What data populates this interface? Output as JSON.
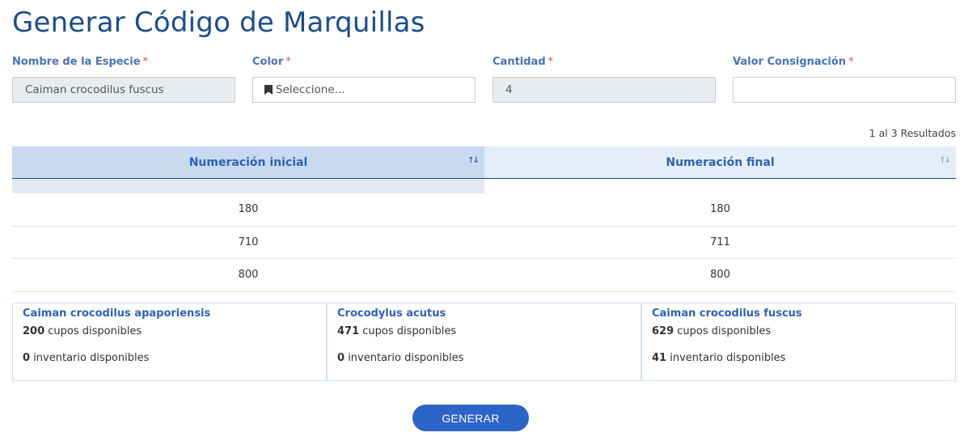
{
  "page": {
    "title": "Generar Código de Marquillas"
  },
  "form": {
    "species": {
      "label": "Nombre de la Especie",
      "required_mark": "*",
      "value": "Caiman crocodilus fuscus"
    },
    "color": {
      "label": "Color",
      "required_mark": "*",
      "placeholder": "Seleccione...",
      "icon": "bookmark-icon"
    },
    "quantity": {
      "label": "Cantidad",
      "required_mark": "*",
      "value": "4"
    },
    "consignment": {
      "label": "Valor Consignación",
      "required_mark": "*",
      "value": ""
    }
  },
  "table": {
    "results_text": "1 al 3 Resultados",
    "columns": [
      "Numeración inicial",
      "Numeración final"
    ],
    "rows": [
      [
        "180",
        "180"
      ],
      [
        "710",
        "711"
      ],
      [
        "800",
        "800"
      ]
    ]
  },
  "summary": [
    {
      "species": "Caiman crocodilus apaporiensis",
      "quota": "200",
      "quota_text": "cupos disponibles",
      "inventory": "0",
      "inventory_text": "inventario disponibles"
    },
    {
      "species": "Crocodylus acutus",
      "quota": "471",
      "quota_text": "cupos disponibles",
      "inventory": "0",
      "inventory_text": "inventario disponibles"
    },
    {
      "species": "Caiman crocodilus fuscus",
      "quota": "629",
      "quota_text": "cupos disponibles",
      "inventory": "41",
      "inventory_text": "inventario disponibles"
    }
  ],
  "actions": {
    "generate_label": "GENERAR"
  },
  "colors": {
    "title": "#1a4d8c",
    "accent": "#2e63b5",
    "required": "#d9534f",
    "button": "#2d64c8"
  }
}
